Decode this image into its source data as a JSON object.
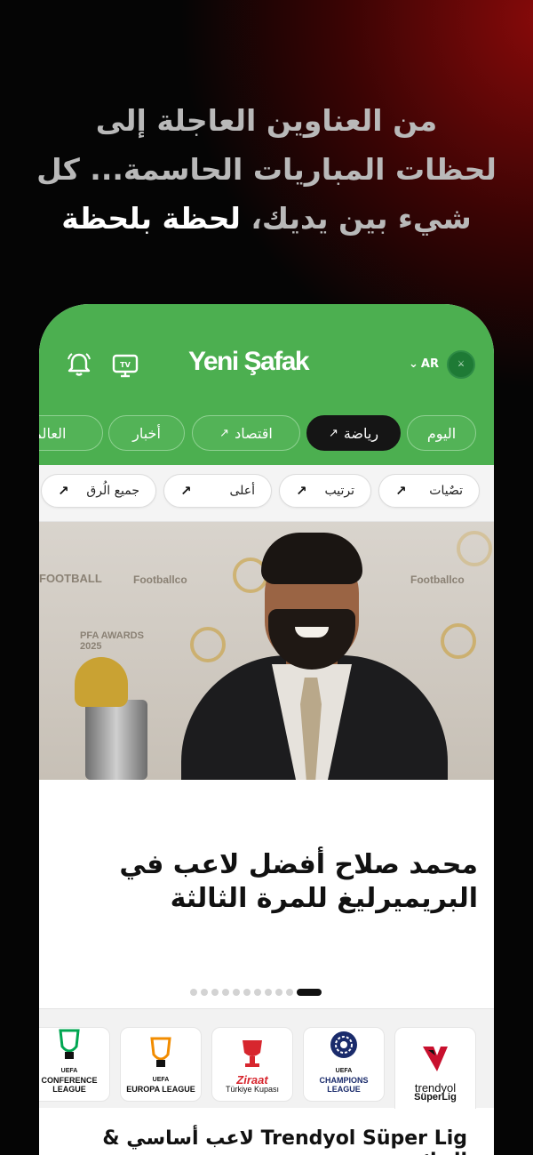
{
  "headline": {
    "line1": "من العناوين العاجلة إلى",
    "line2": "لحظات المباريات الحاسمة... كل",
    "line3_plain": "شيء بين يديك، ",
    "line3_strong": "لحظة بلحظة"
  },
  "header": {
    "logo": "Yeni Şafak",
    "lang": "AR",
    "lang_chevron": "⌄",
    "tv_label": "TV"
  },
  "categories": [
    {
      "label": "اليوم",
      "arrow": ""
    },
    {
      "label": "رياضة",
      "arrow": "↗"
    },
    {
      "label": "اقتصاد",
      "arrow": "↗"
    },
    {
      "label": "أخبار",
      "arrow": ""
    },
    {
      "label": "العالمية",
      "arrow": ""
    }
  ],
  "subcategories": [
    {
      "label": "تصٌيات",
      "arrow": "↗"
    },
    {
      "label": "ترتيب",
      "arrow": "↗"
    },
    {
      "label": "أعلى",
      "arrow": "↗"
    },
    {
      "label": "جميع الُرق",
      "arrow": "↗"
    }
  ],
  "hero": {
    "title_line1": "محمد صلاح أفضل لاعب في",
    "title_line2": "البريميرليغ للمرة الثالثة",
    "backdrop_labels": [
      "FOOTBALL",
      "Footballco",
      "Footballco",
      "PFA AWARDS 2025"
    ],
    "slide_count": 11,
    "active_slide": 10
  },
  "leagues": [
    {
      "line1": "trendyol",
      "line2": "SüperLig",
      "color": "#c8102e"
    },
    {
      "line1": "UEFA",
      "line2": "CHAMPIONS LEAGUE",
      "color": "#1a2b6b"
    },
    {
      "line1": "Ziraat",
      "line2": "Türkiye Kupası",
      "color": "#d7262e"
    },
    {
      "line1": "UEFA",
      "line2": "EUROPA LEAGUE",
      "color": "#f28c00"
    },
    {
      "line1": "UEFA",
      "line2": "CONFERENCE LEAGUE",
      "color": "#00a651"
    }
  ],
  "section": {
    "title": "Trendyol Süper Lig لاعب أساسي & النتائج"
  },
  "colors": {
    "app_green": "#4caf50",
    "active_tab": "#151515"
  }
}
